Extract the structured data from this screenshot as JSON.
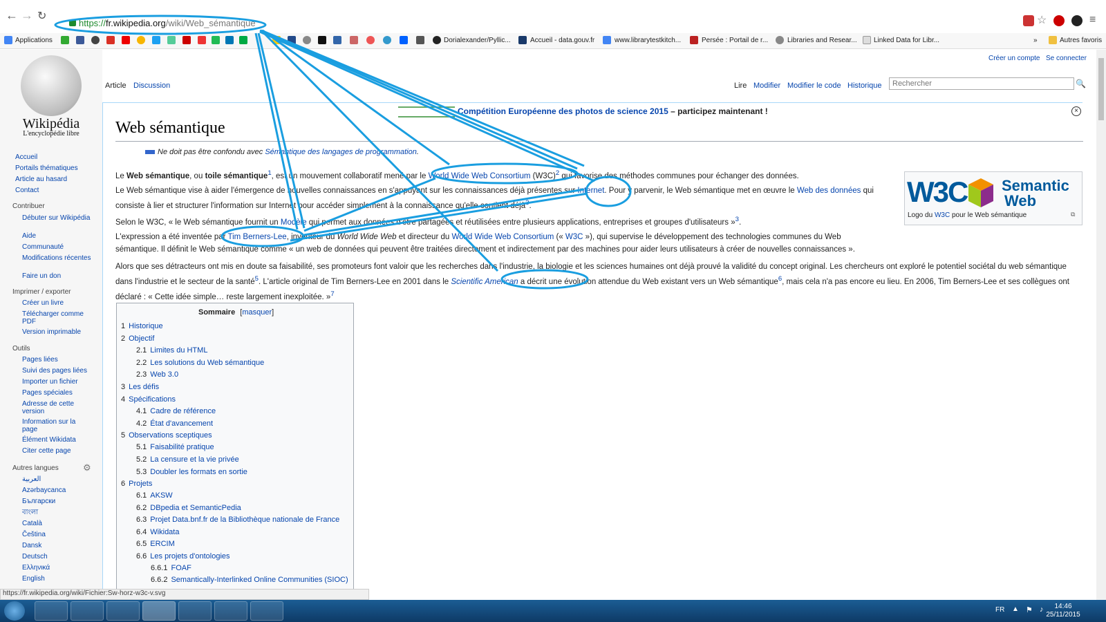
{
  "browser": {
    "url_proto": "https://",
    "url_host": "fr.wikipedia.org",
    "url_path": "/wiki/Web_sémantique",
    "bookmarks": [
      "Applications",
      "Dorialexander/Pyllic...",
      "Accueil - data.gouv.fr",
      "www.librarytestkitch...",
      "Persée : Portail de r...",
      "Libraries and Resear...",
      "Linked Data for Libr...",
      "Autres favoris"
    ],
    "status_url": "https://fr.wikipedia.org/wiki/Fichier:Sw-horz-w3c-v.svg"
  },
  "account": {
    "create": "Créer un compte",
    "login": "Se connecter"
  },
  "tabs": {
    "article": "Article",
    "discussion": "Discussion",
    "read": "Lire",
    "edit": "Modifier",
    "edit_code": "Modifier le code",
    "history": "Historique"
  },
  "search": {
    "placeholder": "Rechercher"
  },
  "logo": {
    "title": "Wikipédia",
    "subtitle": "L'encyclopédie libre"
  },
  "sidebar": {
    "nav": [
      "Accueil",
      "Portails thématiques",
      "Article au hasard",
      "Contact"
    ],
    "contribute_h": "Contribuer",
    "contribute": [
      "Débuter sur Wikipédia",
      "Aide",
      "Communauté",
      "Modifications récentes",
      "Faire un don"
    ],
    "print_h": "Imprimer / exporter",
    "print": [
      "Créer un livre",
      "Télécharger comme PDF",
      "Version imprimable"
    ],
    "tools_h": "Outils",
    "tools": [
      "Pages liées",
      "Suivi des pages liées",
      "Importer un fichier",
      "Pages spéciales",
      "Adresse de cette version",
      "Information sur la page",
      "Élément Wikidata",
      "Citer cette page"
    ],
    "langs_h": "Autres langues",
    "langs": [
      "العربية",
      "Azərbaycanca",
      "Български",
      "বাংলা",
      "Català",
      "Čeština",
      "Dansk",
      "Deutsch",
      "Ελληνικά",
      "English"
    ]
  },
  "notice": {
    "link": "Compétition Européenne des photos de science 2015",
    "rest": " – participez maintenant !"
  },
  "article": {
    "title": "Web sémantique",
    "hatnote_pre": "Ne doit pas être confondu avec ",
    "hatnote_link": "Sémantique des langages de programmation",
    "hatnote_post": ".",
    "p1": {
      "a": "Le ",
      "b": "Web sémantique",
      "c": ", ou ",
      "d": "toile sémantique",
      "sup": "1",
      "e": ", est un mouvement collaboratif mené par le ",
      "link": "World Wide Web Consortium",
      "f": " (W3C)",
      "sup2": "2",
      "g": " qui favorise des méthodes communes pour échanger des données."
    },
    "p2": {
      "a": "Le Web sémantique vise à aider l'émergence de nouvelles connaissances en s'appuyant sur les connaissances déjà présentes sur ",
      "link1": "Internet",
      "b": ". Pour y parvenir, le Web sémantique met en œuvre le ",
      "link2": "Web des données",
      "c": " qui consiste à lier et structurer l'information sur Internet pour accéder simplement à la connaissance qu'elle contient déjà",
      "sup": "3",
      "d": "."
    },
    "p3": {
      "a": "Selon le W3C, « le Web sémantique fournit un ",
      "link": "Modèle",
      "b": " qui permet aux données d'être partagées et réutilisées entre plusieurs applications, entreprises et groupes d'utilisateurs »",
      "sup": "3",
      "c": "."
    },
    "p4": {
      "a": "L'expression a été inventée par ",
      "link1": "Tim Berners-Lee",
      "b": ", inventeur du ",
      "em": "World Wide Web",
      "c": " et directeur du ",
      "link2": "World Wide Web Consortium",
      "d": " (« ",
      "link3": "W3C",
      "e": " »), qui supervise le développement des technologies communes du Web sémantique. Il définit le Web sémantique comme « un web de données qui peuvent être traitées directement et indirectement par des machines pour aider leurs utilisateurs à créer de nouvelles connaissances »."
    },
    "p5": {
      "a": "Alors que ses détracteurs ont mis en doute sa faisabilité, ses promoteurs font valoir que les recherches dans l'industrie, la biologie et les sciences humaines ont déjà prouvé la validité du concept original. Les chercheurs ont exploré le potentiel sociétal du web sémantique dans l'industrie et le secteur de la santé",
      "sup": "5",
      "b": ". L'article original de Tim Berners-Lee en 2001 dans le ",
      "link": "Scientific American",
      "c": " a décrit une évolution attendue du Web existant vers un Web sémantique",
      "sup2": "6",
      "d": ", mais cela n'a pas encore eu lieu. En 2006, Tim Berners-Lee et ses collègues ont déclaré : « Cette idée simple… reste largement inexploitée. »",
      "sup3": "7"
    }
  },
  "infobox": {
    "logo": "W3C",
    "semantic": "Semantic",
    "web": "Web",
    "caption_pre": "Logo du ",
    "caption_link": "W3C",
    "caption_post": " pour le Web sémantique"
  },
  "toc": {
    "title": "Sommaire",
    "toggle": "masquer",
    "items": [
      {
        "n": "1",
        "t": "Historique"
      },
      {
        "n": "2",
        "t": "Objectif"
      },
      {
        "n": "2.1",
        "t": "Limites du HTML"
      },
      {
        "n": "2.2",
        "t": "Les solutions du Web sémantique"
      },
      {
        "n": "2.3",
        "t": "Web 3.0"
      },
      {
        "n": "3",
        "t": "Les défis"
      },
      {
        "n": "4",
        "t": "Spécifications"
      },
      {
        "n": "4.1",
        "t": "Cadre de référence"
      },
      {
        "n": "4.2",
        "t": "État d'avancement"
      },
      {
        "n": "5",
        "t": "Observations sceptiques"
      },
      {
        "n": "5.1",
        "t": "Faisabilité pratique"
      },
      {
        "n": "5.2",
        "t": "La censure et la vie privée"
      },
      {
        "n": "5.3",
        "t": "Doubler les formats en sortie"
      },
      {
        "n": "6",
        "t": "Projets"
      },
      {
        "n": "6.1",
        "t": "AKSW"
      },
      {
        "n": "6.2",
        "t": "DBpedia et SemanticPedia"
      },
      {
        "n": "6.3",
        "t": "Projet Data.bnf.fr de la Bibliothèque nationale de France"
      },
      {
        "n": "6.4",
        "t": "Wikidata"
      },
      {
        "n": "6.5",
        "t": "ERCIM"
      },
      {
        "n": "6.6",
        "t": "Les projets d'ontologies"
      },
      {
        "n": "6.6.1",
        "t": "FOAF"
      },
      {
        "n": "6.6.2",
        "t": "Semantically-Interlinked Online Communities (SIOC)"
      }
    ]
  },
  "system": {
    "lang": "FR",
    "time": "14:46",
    "date": "25/11/2015"
  },
  "colors": {
    "annotation": "#1a9ee0",
    "link": "#0645ad",
    "taskbar": "#1b5d94"
  }
}
